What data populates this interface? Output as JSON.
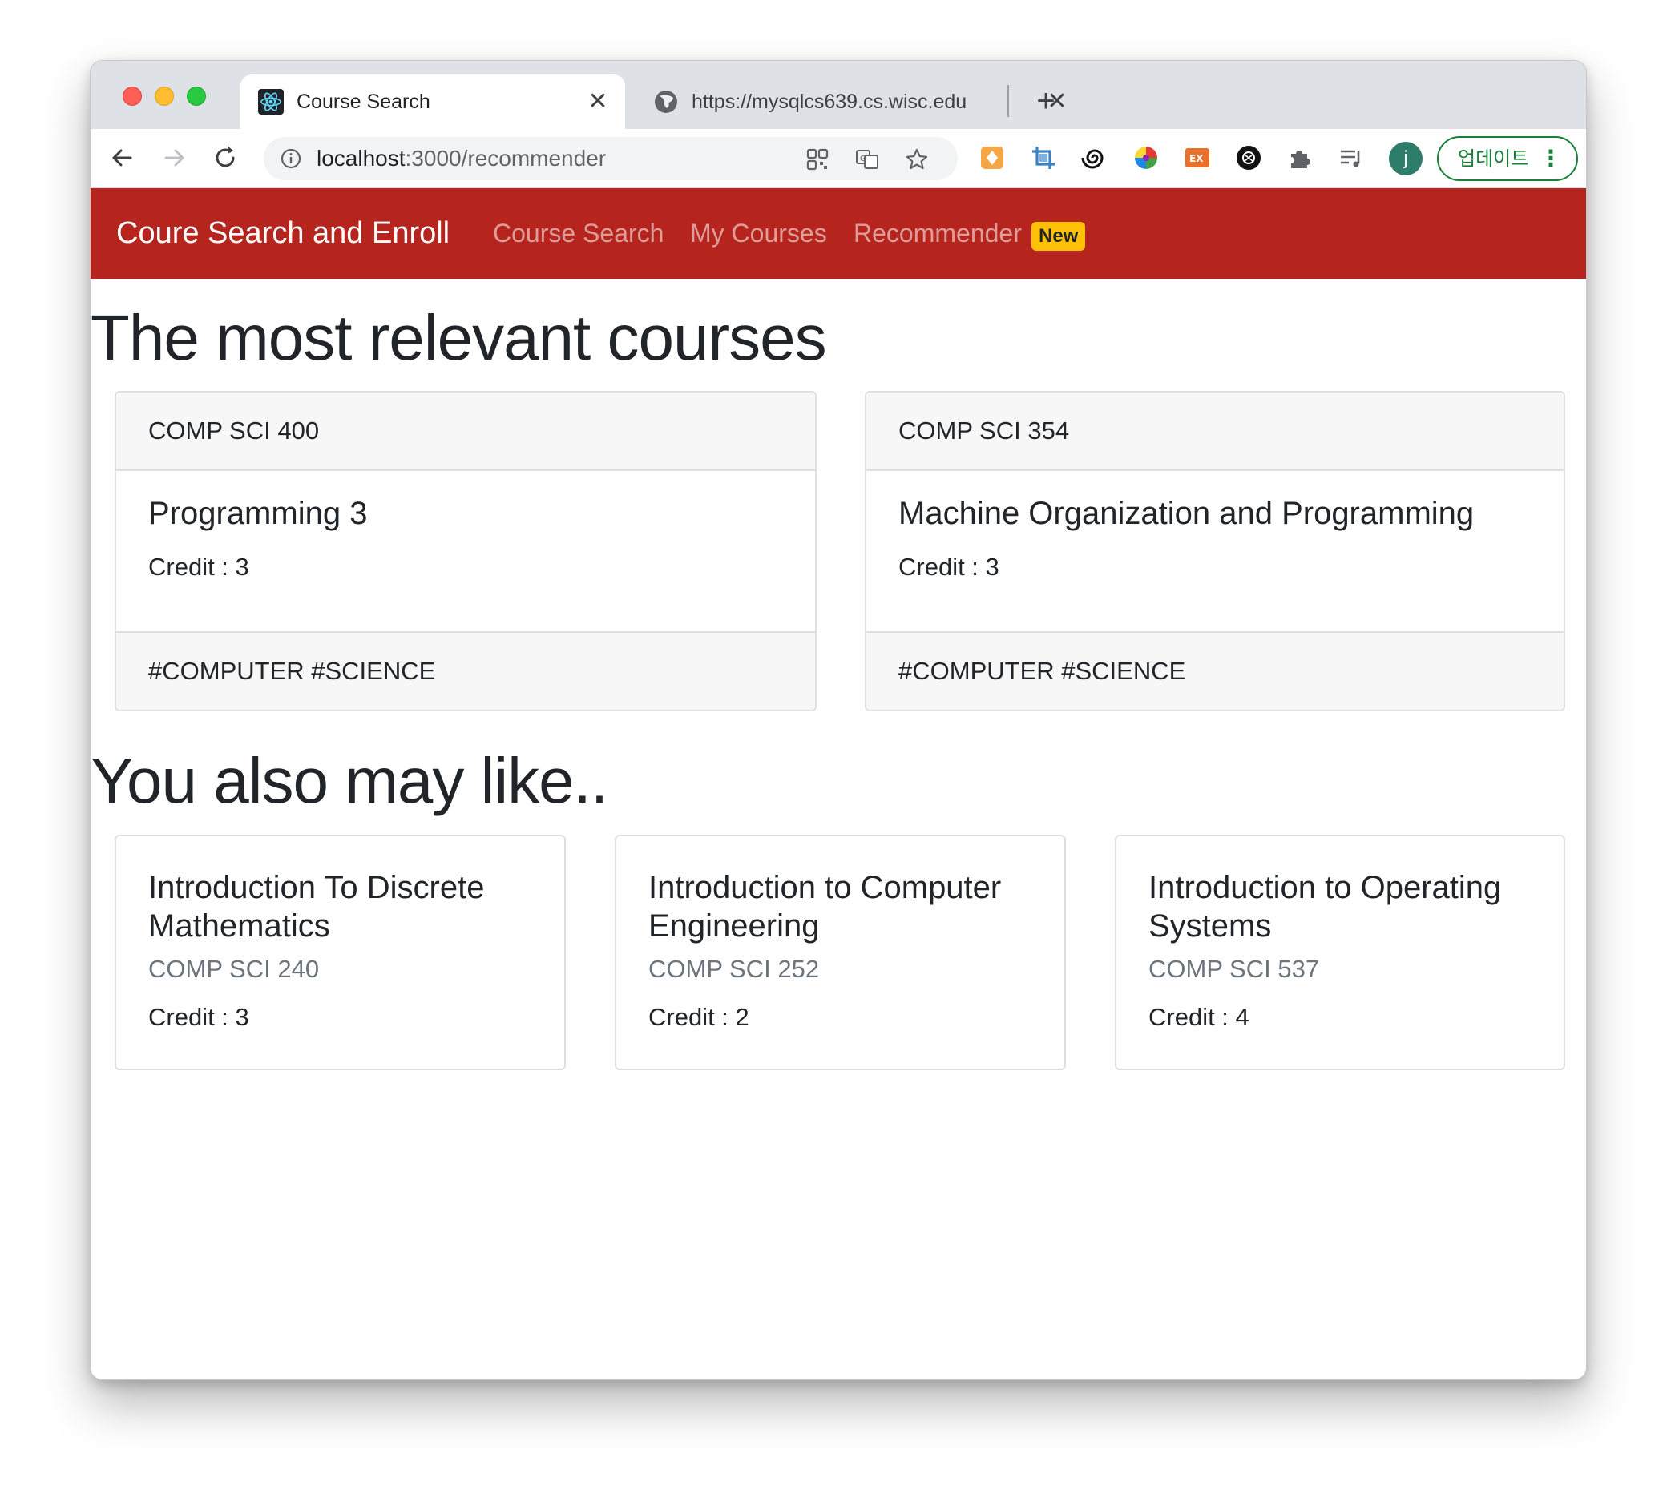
{
  "browser": {
    "tabs": [
      {
        "title": "Course Search",
        "active": true,
        "favicon": "react-icon"
      },
      {
        "title": "https://mysqlcs639.cs.wisc.edu",
        "active": false,
        "favicon": "globe-icon"
      }
    ],
    "url_host": "localhost",
    "url_path": ":3000/recommender",
    "profile_initial": "j",
    "update_label": "업데이트"
  },
  "navbar": {
    "brand": "Coure Search and Enroll",
    "links": [
      "Course Search",
      "My Courses",
      "Recommender"
    ],
    "badge": "New"
  },
  "relevant": {
    "heading": "The most relevant courses",
    "courses": [
      {
        "code": "COMP SCI 400",
        "name": "Programming 3",
        "credit": "Credit : 3",
        "tags": "#COMPUTER #SCIENCE"
      },
      {
        "code": "COMP SCI 354",
        "name": "Machine Organization and Programming",
        "credit": "Credit : 3",
        "tags": "#COMPUTER #SCIENCE"
      }
    ]
  },
  "also_like": {
    "heading": "You also may like..",
    "courses": [
      {
        "name_line1": "Introduction To Discrete",
        "name_line2": "Mathematics",
        "code": "COMP SCI 240",
        "credit": "Credit : 3"
      },
      {
        "name_line1": "Introduction to Computer",
        "name_line2": "Engineering",
        "code": "COMP SCI 252",
        "credit": "Credit : 2"
      },
      {
        "name_line1": "Introduction to Operating",
        "name_line2": "Systems",
        "code": "COMP SCI 537",
        "credit": "Credit : 4"
      }
    ]
  },
  "colors": {
    "navbar": "#b5251d",
    "badge": "#ffc107",
    "update_green": "#188038"
  }
}
